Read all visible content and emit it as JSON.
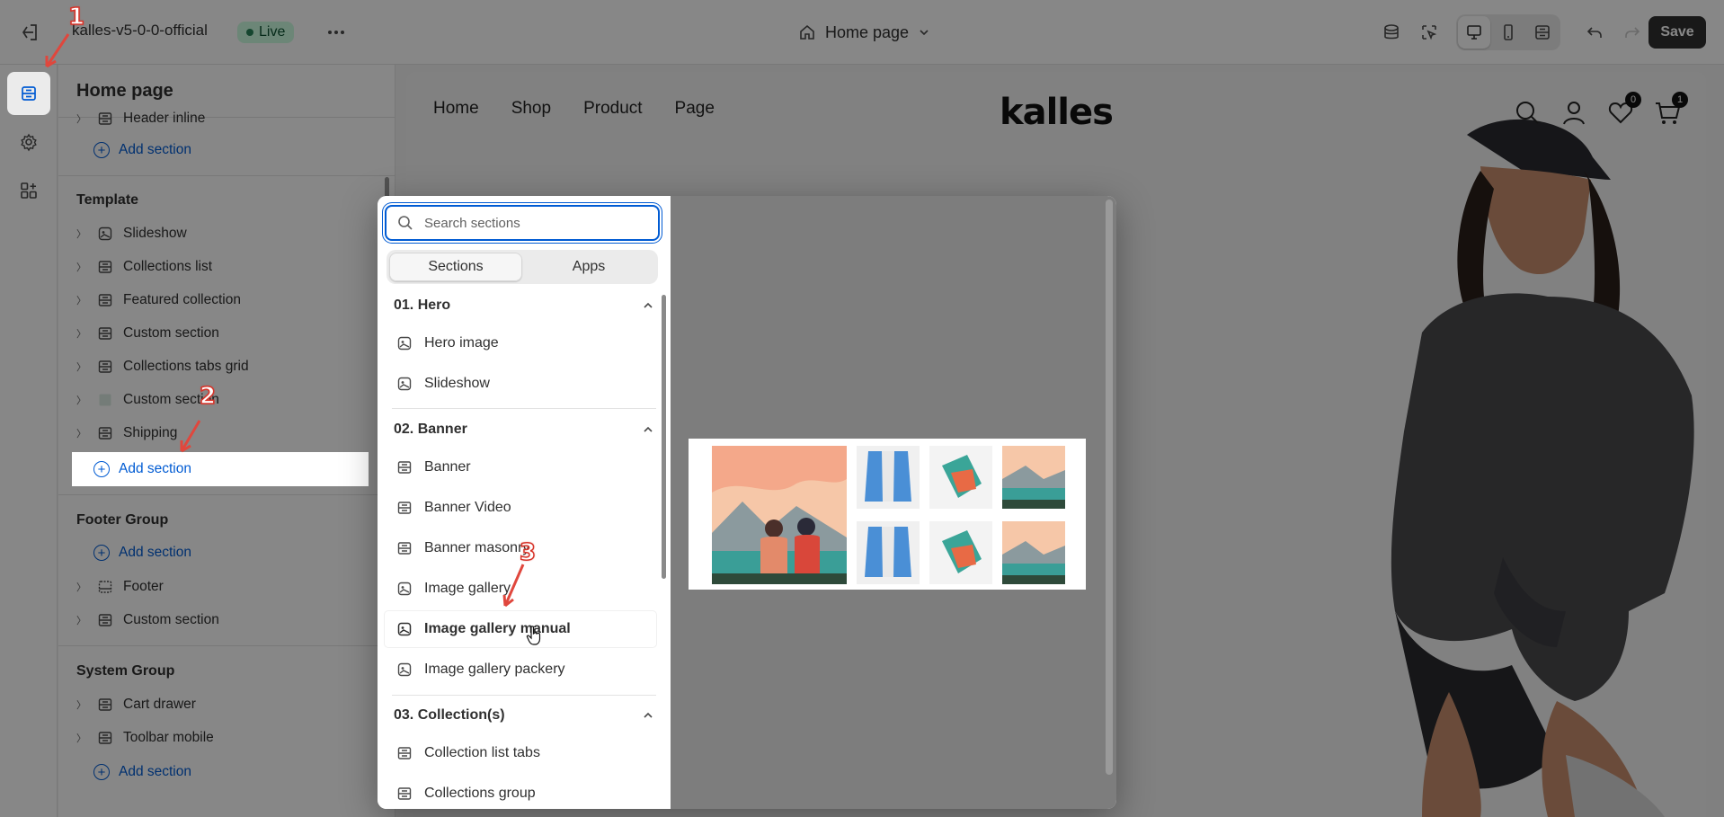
{
  "topbar": {
    "store_name": "kalles-v5-0-0-official",
    "live_label": "Live",
    "page_selector": "Home page",
    "save_label": "Save"
  },
  "rail": {
    "items": [
      "sections-icon",
      "settings-icon",
      "apps-icon"
    ]
  },
  "sidebar": {
    "title": "Home page",
    "header_partial": "Header inline",
    "header_add": "Add section",
    "template": {
      "title": "Template",
      "items": [
        "Slideshow",
        "Collections list",
        "Featured collection",
        "Custom section",
        "Collections tabs grid",
        "Custom section",
        "Shipping"
      ],
      "add": "Add section"
    },
    "footer": {
      "title": "Footer Group",
      "add": "Add section",
      "items": [
        "Footer",
        "Custom section"
      ]
    },
    "system": {
      "title": "System Group",
      "items": [
        "Cart drawer",
        "Toolbar mobile"
      ],
      "add": "Add section"
    }
  },
  "picker": {
    "search_placeholder": "Search sections",
    "tabs": [
      "Sections",
      "Apps"
    ],
    "categories": [
      {
        "title": "01. Hero",
        "items": [
          "Hero image",
          "Slideshow"
        ]
      },
      {
        "title": "02. Banner",
        "items": [
          "Banner",
          "Banner Video",
          "Banner masonry",
          "Image gallery",
          "Image gallery manual",
          "Image gallery packery"
        ]
      },
      {
        "title": "03. Collection(s)",
        "items": [
          "Collection list tabs",
          "Collections group"
        ]
      }
    ],
    "highlighted_item": "Image gallery manual"
  },
  "storefront": {
    "nav": [
      "Home",
      "Shop",
      "Product",
      "Page"
    ],
    "logo": "kalles",
    "wishlist_count": "0",
    "cart_count": "1"
  },
  "annotations": [
    "1",
    "2",
    "3"
  ],
  "colors": {
    "accent": "#005bd3",
    "live_bg": "#cdfee1",
    "save_bg": "#303030",
    "annotation": "#d7342a"
  }
}
